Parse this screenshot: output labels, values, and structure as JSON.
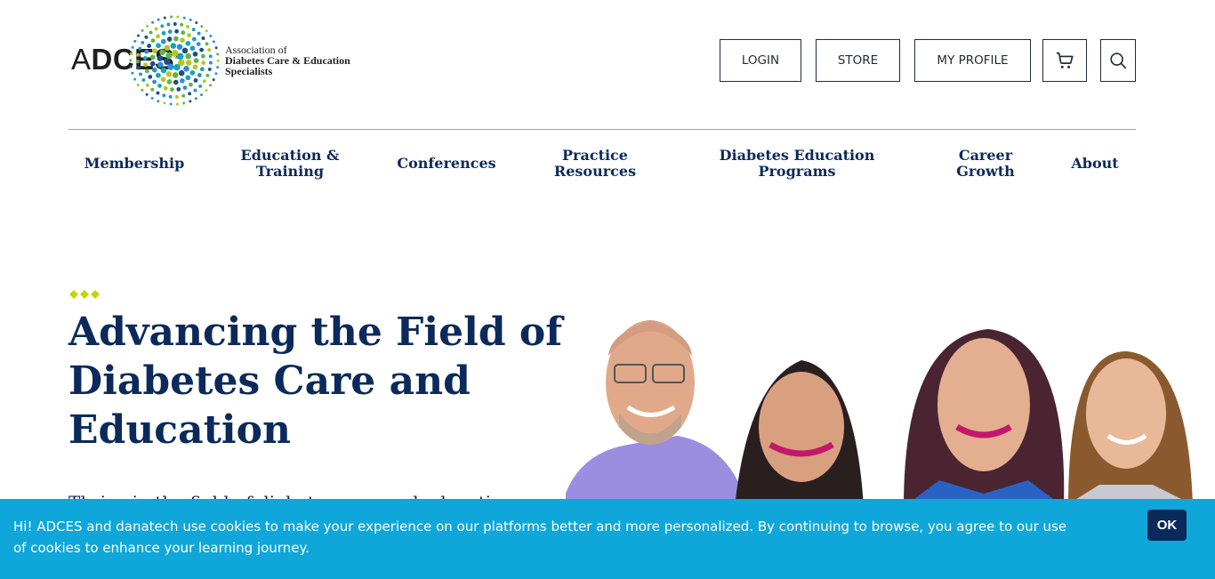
{
  "logo": {
    "wordmark": "ADCES",
    "registered": "®",
    "tagline_lines": [
      "Association of",
      "Diabetes Care & Education",
      "Specialists"
    ],
    "colors": {
      "lime": "#b4c81d",
      "teal": "#1aa3b8",
      "blue": "#2d8fd4",
      "navy": "#1b4f8c",
      "green": "#5fb447"
    }
  },
  "utility_nav": {
    "login": "LOGIN",
    "store": "STORE",
    "my_profile": "MY PROFILE",
    "cart_icon": "cart-icon",
    "search_icon": "search-icon"
  },
  "main_nav": [
    "Membership",
    "Education & Training",
    "Conferences",
    "Practice Resources",
    "Diabetes Education Programs",
    "Career Growth",
    "About"
  ],
  "hero": {
    "title": "Advancing the Field of Diabetes Care and Education",
    "subtitle_partial": "Thrive in the field of diabetes care and education",
    "accent_color": "#c8d400"
  },
  "cookie_banner": {
    "text": "Hi! ADCES and danatech use cookies to make your experience on our platforms better and more personalized. By continuing to browse, you agree to our use of cookies to enhance your learning journey.",
    "ok": "OK",
    "background": "#0fa7d9"
  },
  "colors": {
    "navy": "#0b2a5b",
    "rule": "#b7b31d"
  }
}
